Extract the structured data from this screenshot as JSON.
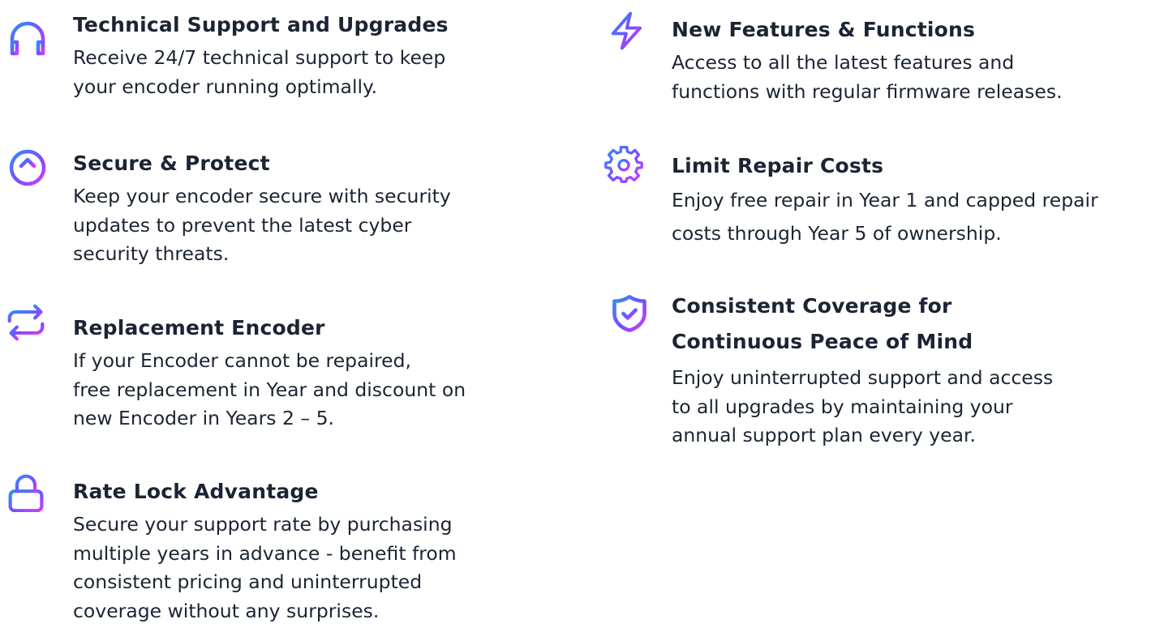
{
  "colors": {
    "gradient_start": "#2f8cff",
    "gradient_mid": "#7a4dff",
    "gradient_end": "#d13cff",
    "text": "#1c2434"
  },
  "left_column": {
    "items": [
      {
        "icon": "headphones-icon",
        "title": "Technical Support and Upgrades",
        "lines": [
          "Receive 24/7 technical support to keep",
          "your encoder running optimally."
        ]
      },
      {
        "icon": "arrow-up-circle-icon",
        "title": "Secure & Protect",
        "lines": [
          "Keep your encoder secure with security",
          "updates to prevent the latest cyber",
          "security threats."
        ]
      },
      {
        "icon": "repeat-arrows-icon",
        "title": "Replacement Encoder",
        "lines": [
          "If your Encoder cannot be repaired,",
          "free replacement in Year and discount on",
          "new Encoder in Years 2 – 5."
        ]
      },
      {
        "icon": "lock-icon",
        "title": "Rate Lock Advantage",
        "lines": [
          "Secure your support rate by purchasing",
          "multiple years in advance - benefit from",
          "consistent pricing and uninterrupted",
          "coverage without any surprises."
        ]
      }
    ]
  },
  "right_column": {
    "items": [
      {
        "icon": "lightning-icon",
        "title": "New Features & Functions",
        "lines": [
          "Access to all the latest features and",
          "functions with regular firmware releases."
        ]
      },
      {
        "icon": "gear-icon",
        "title": "Limit Repair Costs",
        "lines": [
          "Enjoy free repair in Year 1 and capped repair",
          "costs through Year 5 of ownership."
        ]
      },
      {
        "icon": "shield-check-icon",
        "title_lines": [
          "Consistent Coverage for",
          "Continuous Peace of Mind"
        ],
        "lines": [
          "Enjoy uninterrupted support and access",
          "to all upgrades by maintaining your",
          "annual support plan every year."
        ]
      }
    ]
  }
}
